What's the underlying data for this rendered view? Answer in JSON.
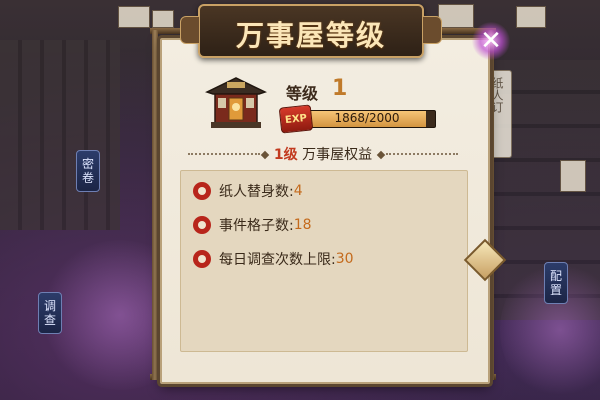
{
  "title": "万事屋等级",
  "close_icon": "close-x-icon",
  "level": {
    "label": "等级",
    "value": "1"
  },
  "exp": {
    "badge": "EXP",
    "text": "1868/2000",
    "current": 1868,
    "max": 2000
  },
  "benefits_header": {
    "level_text": "1级",
    "title": "万事屋权益"
  },
  "benefits": [
    {
      "label": "纸人替身数:",
      "value": "4"
    },
    {
      "label": "事件格子数:",
      "value": "18"
    },
    {
      "label": "每日调查次数上限:",
      "value": "30"
    }
  ],
  "side_signs": {
    "left_top": "密卷",
    "left_bottom": "调查",
    "right": "配置",
    "right_board": "纸人订"
  },
  "colors": {
    "accent": "#c07a2a",
    "bullet": "#b8251b",
    "panel": "#f3ede1",
    "banner": "#3a2a1c"
  }
}
